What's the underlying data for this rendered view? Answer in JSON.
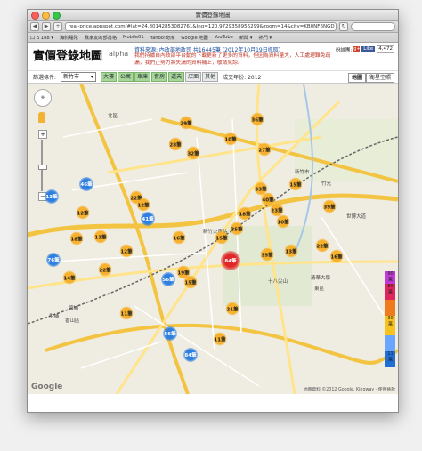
{
  "window": {
    "title": "實價登錄地圖"
  },
  "browser": {
    "url": "real-price.appspot.com/#lat=24.80142853082761&lng=120.9729358956299&zoom=14&city=KB0NF6NGD",
    "bookmarks": [
      "口 ⌂ 188 ▾",
      "海豹睡陀",
      "我家友的部落格",
      "Mobile01",
      "Yahoo!奇摩",
      "Google 地圖",
      "YouTube",
      "新聞 ▾",
      "熱門 ▾"
    ]
  },
  "header": {
    "title": "實價登錄地圖",
    "badge": "alpha",
    "source": "資料來源: 內政部地政司 共16445筆 (2012年10月19日抓取)",
    "notice": "我們持續自內政部平台動的下載更新了更多的資料，但因為資料量大，人工處理難免疏漏，我們正努力將失漏的資料補上，敬請見諒。",
    "fans_label": "粉絲團:",
    "like_label": "Like",
    "fans_count": "4,472"
  },
  "filters": {
    "label": "篩選條件:",
    "city": "新竹市",
    "types": [
      {
        "label": "大樓",
        "on": true
      },
      {
        "label": "公寓",
        "on": true
      },
      {
        "label": "車庫",
        "on": true
      },
      {
        "label": "套房",
        "on": true
      },
      {
        "label": "透天",
        "on": true
      },
      {
        "label": "店面",
        "on": false
      },
      {
        "label": "其他",
        "on": false
      }
    ],
    "year": "成交年份: 2012"
  },
  "map_types": [
    "地圖",
    "衛星空照"
  ],
  "places": [
    "北區",
    "東區",
    "竹光",
    "香山區",
    "新竹火車站",
    "清華大學",
    "頂埔",
    "牛埔",
    "世博大道",
    "新竹市",
    "十八尖山"
  ],
  "clusters": [
    {
      "label": "29筆",
      "color": "orange"
    },
    {
      "label": "36筆",
      "color": "orange"
    },
    {
      "label": "28筆",
      "color": "orange"
    },
    {
      "label": "10筆",
      "color": "orange"
    },
    {
      "label": "32筆",
      "color": "orange"
    },
    {
      "label": "27筆",
      "color": "orange"
    },
    {
      "label": "46筆",
      "color": "blue"
    },
    {
      "label": "22筆",
      "color": "orange"
    },
    {
      "label": "12筆",
      "color": "orange"
    },
    {
      "label": "13筆",
      "color": "blue"
    },
    {
      "label": "12筆",
      "color": "orange"
    },
    {
      "label": "41筆",
      "color": "blue"
    },
    {
      "label": "33筆",
      "color": "orange"
    },
    {
      "label": "40筆",
      "color": "orange"
    },
    {
      "label": "23筆",
      "color": "orange"
    },
    {
      "label": "15筆",
      "color": "orange"
    },
    {
      "label": "39筆",
      "color": "orange"
    },
    {
      "label": "10筆",
      "color": "orange"
    },
    {
      "label": "18筆",
      "color": "orange"
    },
    {
      "label": "11筆",
      "color": "orange"
    },
    {
      "label": "12筆",
      "color": "orange"
    },
    {
      "label": "76筆",
      "color": "blue"
    },
    {
      "label": "18筆",
      "color": "orange"
    },
    {
      "label": "35筆",
      "color": "orange"
    },
    {
      "label": "15筆",
      "color": "orange"
    },
    {
      "label": "16筆",
      "color": "orange"
    },
    {
      "label": "84筆",
      "color": "red"
    },
    {
      "label": "35筆",
      "color": "orange"
    },
    {
      "label": "13筆",
      "color": "orange"
    },
    {
      "label": "22筆",
      "color": "orange"
    },
    {
      "label": "16筆",
      "color": "orange"
    },
    {
      "label": "14筆",
      "color": "orange"
    },
    {
      "label": "22筆",
      "color": "orange"
    },
    {
      "label": "19筆",
      "color": "orange"
    },
    {
      "label": "15筆",
      "color": "orange"
    },
    {
      "label": "21筆",
      "color": "orange"
    },
    {
      "label": "11筆",
      "color": "orange"
    },
    {
      "label": "56筆",
      "color": "blue"
    },
    {
      "label": "56筆",
      "color": "blue"
    },
    {
      "label": "84筆",
      "color": "blue"
    },
    {
      "label": "11筆",
      "color": "orange"
    }
  ],
  "legend": [
    {
      "label": "90萬",
      "color": "#c23bd6"
    },
    {
      "label": "80萬",
      "color": "#e0245c"
    },
    {
      "label": "",
      "color": "#f07a1c"
    },
    {
      "label": "30萬",
      "color": "#f7c21e"
    },
    {
      "label": "",
      "color": "#6aa6ff"
    },
    {
      "label": "11萬",
      "color": "#1f6fd6"
    }
  ],
  "footer": {
    "google": "Google",
    "copyright": "地圖資料 ©2012 Google, Kingway · 使用條款"
  }
}
